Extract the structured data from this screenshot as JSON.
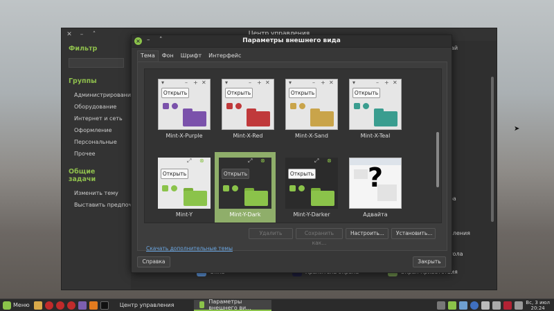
{
  "control_center": {
    "title": "Центр управления",
    "filter_heading": "Фильтр",
    "groups_heading": "Группы",
    "groups": [
      "Администрирование",
      "Оборудование",
      "Интернет и сеть",
      "Оформление",
      "Персональные",
      "Прочее"
    ],
    "tasks_heading": "Общие задачи",
    "tasks": [
      "Изменить тему",
      "Выставить предпочтительные приложения"
    ],
    "right_fragments": [
      "ай",
      "ба",
      "вления",
      "тола"
    ],
    "bottom_items": [
      "Окна",
      "Хранитель экрана",
      "Экран приветствия"
    ]
  },
  "dialog": {
    "title": "Параметры внешнего вида",
    "tabs": [
      "Тема",
      "Фон",
      "Шрифт",
      "Интерфейс"
    ],
    "open_label": "Открыть",
    "themes": [
      {
        "name": "Mint-X-Purple",
        "accent": "#7b52ab"
      },
      {
        "name": "Mint-X-Red",
        "accent": "#c0393b"
      },
      {
        "name": "Mint-X-Sand",
        "accent": "#c9a44a"
      },
      {
        "name": "Mint-X-Teal",
        "accent": "#3a9d8f"
      },
      {
        "name": "Mint-Y",
        "accent": "#8bc34a"
      },
      {
        "name": "Mint-Y-Dark",
        "accent": "#8bc34a"
      },
      {
        "name": "Mint-Y-Darker",
        "accent": "#8bc34a"
      },
      {
        "name": "Адвайта",
        "accent": "#000000"
      }
    ],
    "selected_theme": "Mint-Y-Dark",
    "buttons": {
      "delete": "Удалить",
      "save_as": "Сохранить как...",
      "configure": "Настроить...",
      "install": "Установить..."
    },
    "download_link": "Скачать дополнительные темы",
    "help": "Справка",
    "close": "Закрыть"
  },
  "taskbar": {
    "menu": "Меню",
    "tasks": [
      "Центр управления",
      "Параметры внешнего ви..."
    ],
    "clock_date": "Вс, 3 июл",
    "clock_time": "20:24"
  }
}
